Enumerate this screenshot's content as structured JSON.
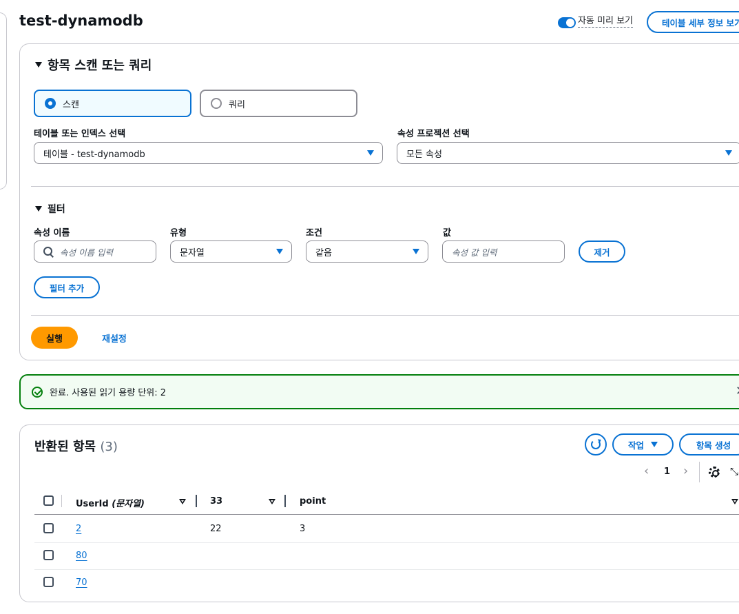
{
  "header": {
    "title": "test-dynamodb",
    "auto_preview_label": "자동 미리 보기",
    "table_details_button": "테이블 세부 정보 보기"
  },
  "scan_panel": {
    "title": "항목 스캔 또는 쿼리",
    "mode_scan": "스캔",
    "mode_query": "쿼리",
    "selected_mode": "scan",
    "table_index_label": "테이블 또는 인덱스 선택",
    "table_index_value": "테이블 - test-dynamodb",
    "projection_label": "속성 프로젝션 선택",
    "projection_value": "모든 속성",
    "filter": {
      "title": "필터",
      "attr_name_label": "속성 이름",
      "attr_name_placeholder": "속성 이름 입력",
      "type_label": "유형",
      "type_value": "문자열",
      "condition_label": "조건",
      "condition_value": "같음",
      "value_label": "값",
      "value_placeholder": "속성 값 입력",
      "remove_button": "제거",
      "add_filter_button": "필터 추가"
    },
    "run_button": "실행",
    "reset_button": "재설정"
  },
  "alert": {
    "message": "완료. 사용된 읽기 용량 단위: 2",
    "status_color": "#037f0c"
  },
  "results": {
    "title": "반환된 항목",
    "count": "(3)",
    "actions_button": "작업",
    "create_item_button": "항목 생성",
    "page_number": "1",
    "columns": [
      {
        "name": "UserId",
        "type": "(문자열)"
      },
      {
        "name": "33",
        "type": ""
      },
      {
        "name": "point",
        "type": ""
      }
    ],
    "rows": [
      {
        "userid": "2",
        "c33": "22",
        "point": "3"
      },
      {
        "userid": "80",
        "c33": "",
        "point": ""
      },
      {
        "userid": "70",
        "c33": "",
        "point": ""
      }
    ]
  },
  "colors": {
    "accent": "#0972d3",
    "primary_button": "#ff9900",
    "success": "#037f0c"
  }
}
